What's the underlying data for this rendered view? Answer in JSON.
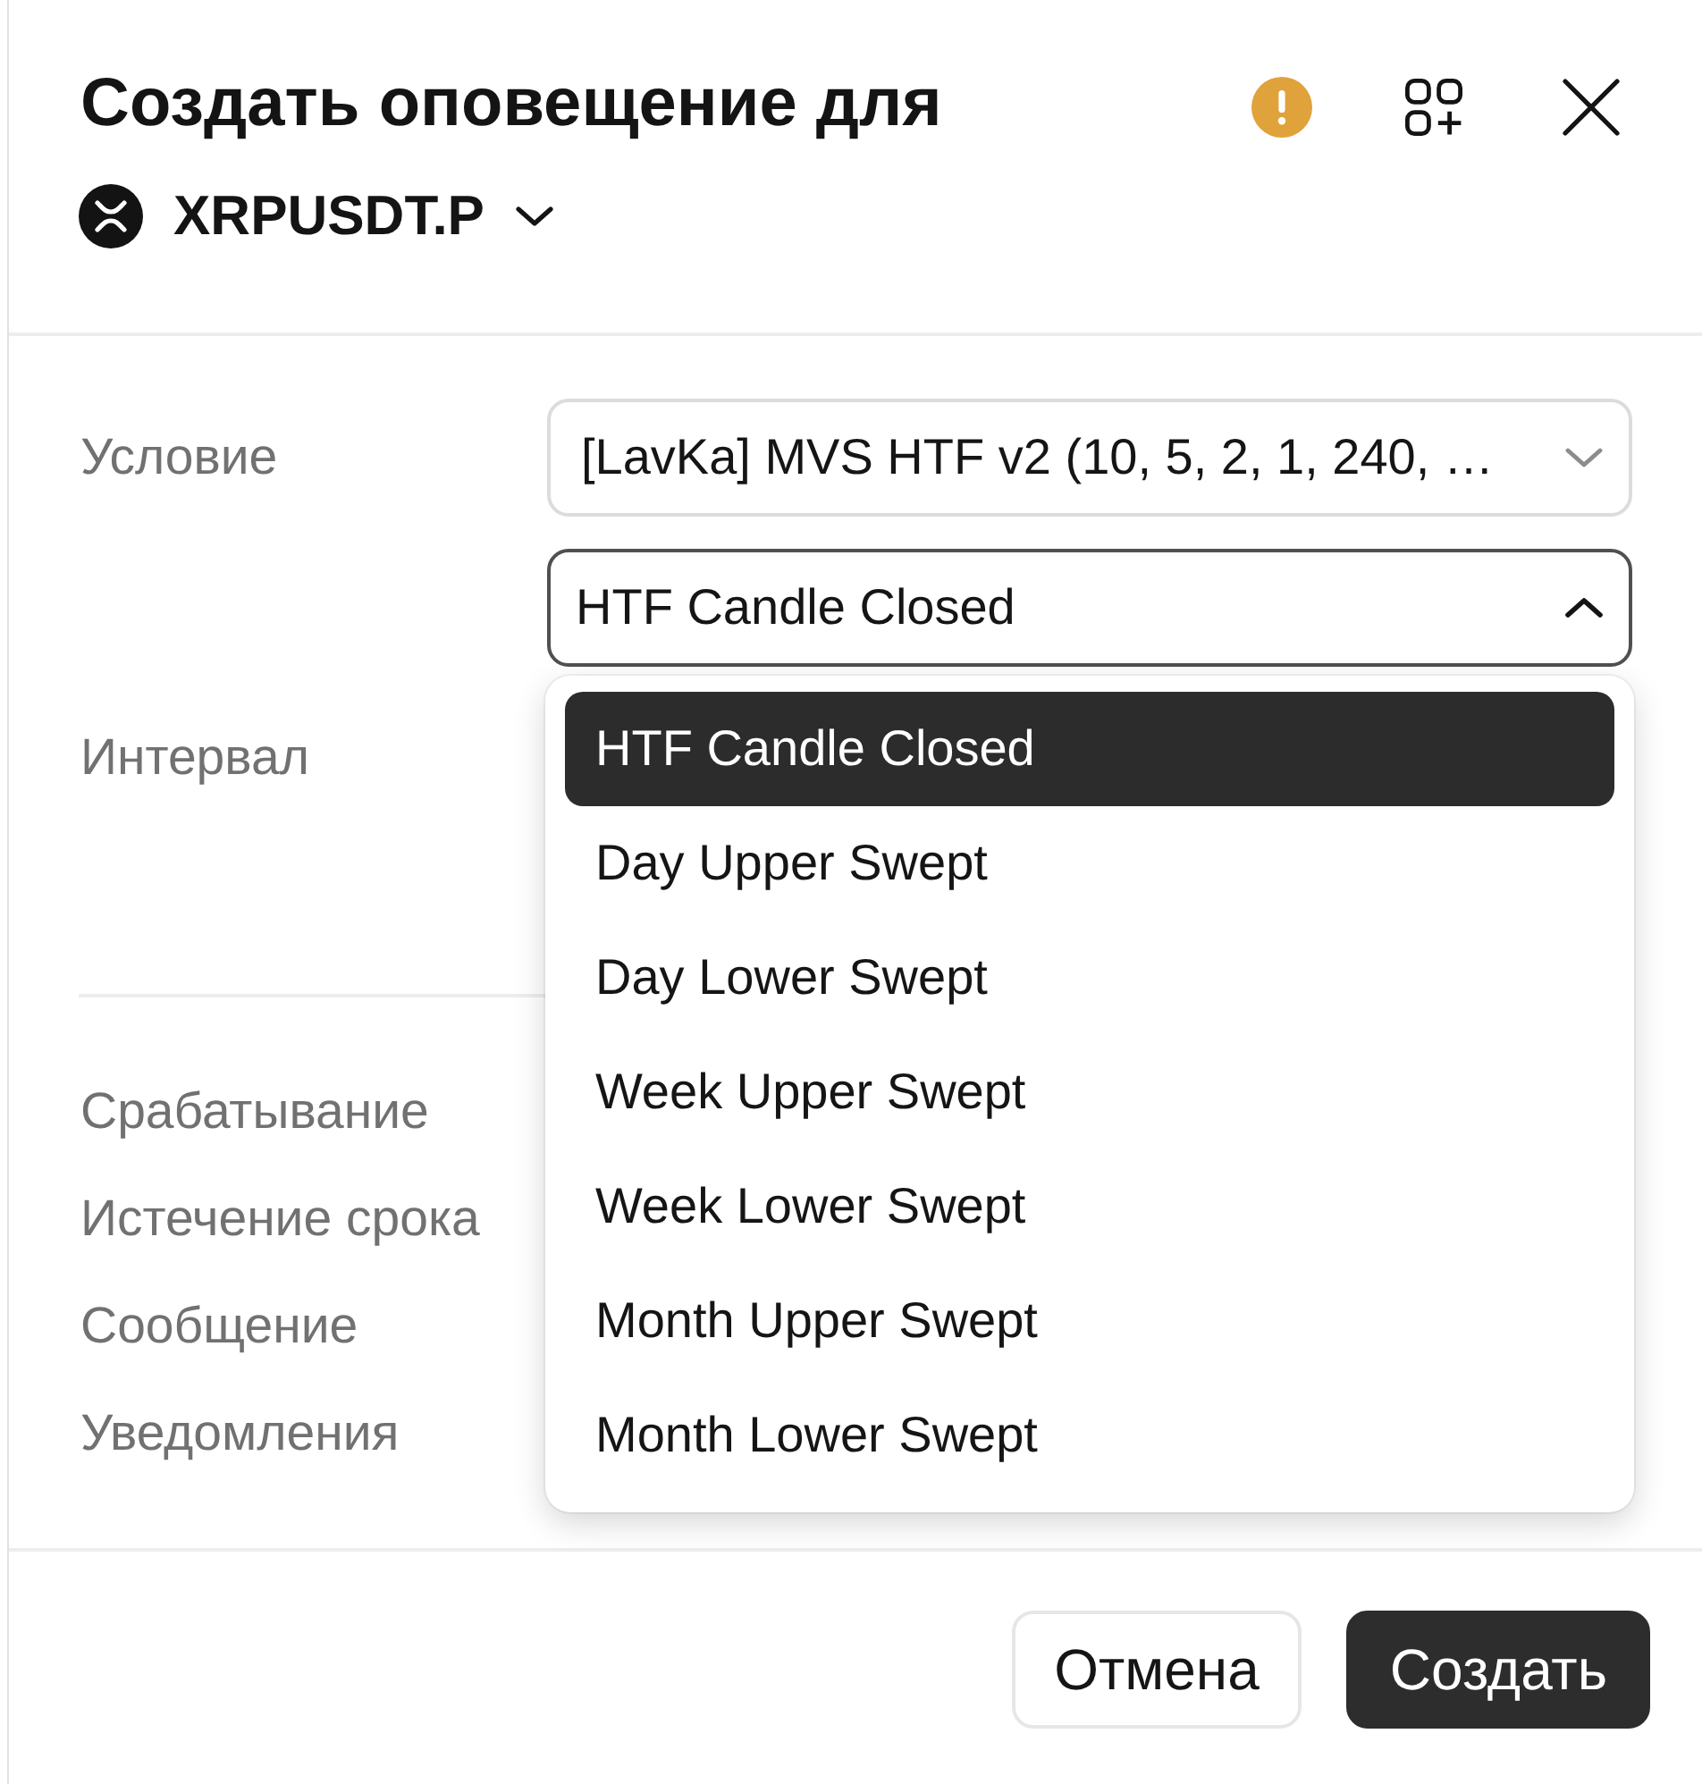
{
  "header": {
    "title": "Создать оповещение для",
    "symbol": "XRPUSDT.P"
  },
  "condition": {
    "label": "Условие",
    "indicator_select": {
      "value": "[LavKa] MVS HTF v2 (10, 5, 2, 1, 240, …",
      "expanded": false
    },
    "event_select": {
      "value": "HTF Candle Closed",
      "expanded": true,
      "options": [
        {
          "label": "HTF Candle Closed",
          "selected": true
        },
        {
          "label": "Day Upper Swept",
          "selected": false
        },
        {
          "label": "Day Lower Swept",
          "selected": false
        },
        {
          "label": "Week Upper Swept",
          "selected": false
        },
        {
          "label": "Week Lower Swept",
          "selected": false
        },
        {
          "label": "Month Upper Swept",
          "selected": false
        },
        {
          "label": "Month Lower Swept",
          "selected": false
        }
      ]
    }
  },
  "interval": {
    "label": "Интервал"
  },
  "settings": [
    {
      "label": "Срабатывание"
    },
    {
      "label": "Истечение срока"
    },
    {
      "label": "Сообщение"
    },
    {
      "label": "Уведомления"
    }
  ],
  "footer": {
    "buttons": [
      {
        "label": "Отмена",
        "kind": "secondary"
      },
      {
        "label": "Создать",
        "kind": "primary"
      }
    ]
  }
}
